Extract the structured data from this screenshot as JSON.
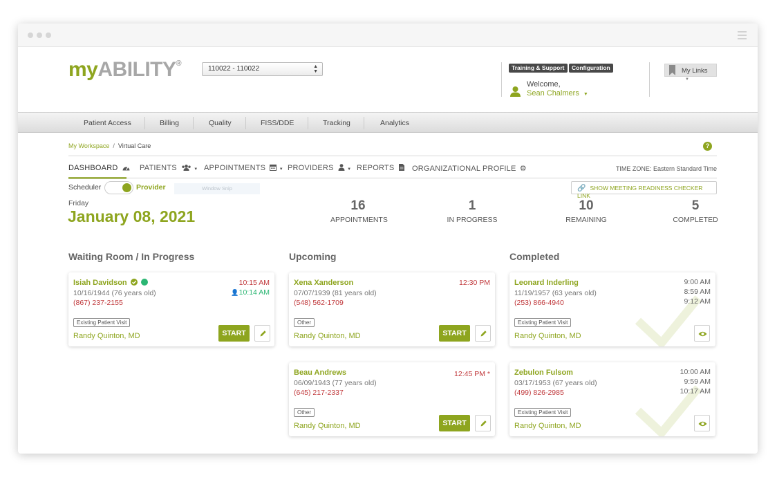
{
  "header": {
    "logo_my": "my",
    "logo_ability": "ABILITY",
    "logo_reg": "®",
    "org_select_value": "110022 - 110022",
    "training_support": "Training & Support",
    "configuration": "Configuration",
    "welcome": "Welcome,",
    "user_name": "Sean Chalmers",
    "my_links": "My Links"
  },
  "topnav": [
    "Patient Access",
    "Billing",
    "Quality",
    "FISS/DDE",
    "Tracking",
    "Analytics"
  ],
  "breadcrumb": {
    "workspace": "My Workspace",
    "sep": "/",
    "current": "Virtual Care"
  },
  "subnav": {
    "dashboard": "DASHBOARD",
    "patients": "PATIENTS",
    "appointments": "APPOINTMENTS",
    "providers": "PROVIDERS",
    "reports": "REPORTS",
    "org_profile": "ORGANIZATIONAL PROFILE",
    "timezone": "TIME ZONE: Eastern Standard Time"
  },
  "toggle": {
    "left": "Scheduler",
    "right": "Provider",
    "snip": "Window Snip"
  },
  "meeting_checker": "SHOW MEETING READINESS CHECKER LINK",
  "date": {
    "weekday": "Friday",
    "full": "January 08, 2021"
  },
  "stats": [
    {
      "num": "16",
      "label": "APPOINTMENTS"
    },
    {
      "num": "1",
      "label": "IN PROGRESS"
    },
    {
      "num": "10",
      "label": "REMAINING"
    },
    {
      "num": "5",
      "label": "COMPLETED"
    }
  ],
  "columns": {
    "waiting": "Waiting Room / In Progress",
    "upcoming": "Upcoming",
    "completed": "Completed"
  },
  "waiting_cards": [
    {
      "name": "Isiah Davidson",
      "dob": "10/16/1944 (76 years old)",
      "phone": "(867) 237-2155",
      "visit_type": "Existing Patient Visit",
      "provider": "Randy Quinton, MD",
      "time_scheduled": "10:15 AM",
      "time_joined": "10:14 AM",
      "start": "START"
    }
  ],
  "upcoming_cards": [
    {
      "name": "Xena Xanderson",
      "dob": "07/07/1939 (81 years old)",
      "phone": "(548) 562-1709",
      "visit_type": "Other",
      "provider": "Randy Quinton, MD",
      "time": "12:30 PM",
      "start": "START"
    },
    {
      "name": "Beau Andrews",
      "dob": "06/09/1943 (77 years old)",
      "phone": "(645) 217-2337",
      "visit_type": "Other",
      "provider": "Randy Quinton, MD",
      "time": "12:45 PM",
      "asterisk": "*",
      "start": "START"
    }
  ],
  "completed_cards": [
    {
      "name": "Leonard Inderling",
      "dob": "11/19/1957 (63 years old)",
      "phone": "(253) 866-4940",
      "visit_type": "Existing Patient Visit",
      "provider": "Randy Quinton, MD",
      "times": [
        "9:00 AM",
        "8:59 AM",
        "9:12 AM"
      ]
    },
    {
      "name": "Zebulon Fulsom",
      "dob": "03/17/1953 (67 years old)",
      "phone": "(499) 826-2985",
      "visit_type": "Existing Patient Visit",
      "provider": "Randy Quinton, MD",
      "times": [
        "10:00 AM",
        "9:59 AM",
        "10:17 AM"
      ]
    }
  ],
  "colors": {
    "accent": "#8ea51f",
    "red": "#c0383b",
    "green": "#2bb673"
  }
}
